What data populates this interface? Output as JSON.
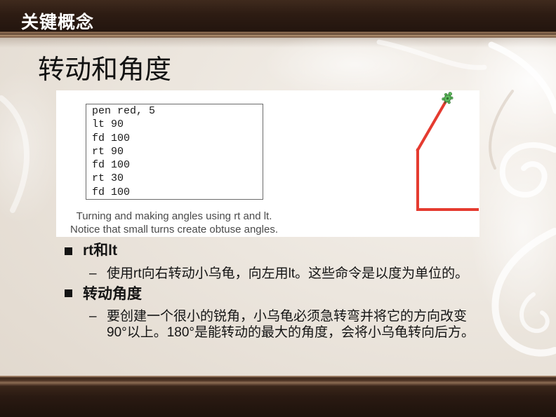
{
  "header": {
    "title": "关键概念"
  },
  "slide": {
    "title": "转动和角度"
  },
  "figure": {
    "code_lines": [
      "pen red, 5",
      "lt 90",
      "fd 100",
      "rt 90",
      "fd 100",
      "rt 30",
      "fd 100"
    ],
    "caption_lines": [
      "Turning and making angles using rt and lt.",
      "Notice that small turns create obtuse angles."
    ],
    "pen_color": "#e53b30",
    "turtle_color": "#5cb85c"
  },
  "bullets": [
    {
      "marker_icon": "square-bullet",
      "label": "rt和lt",
      "sub_marker": "–",
      "sub_lines": [
        "使用rt向右转动小乌龟，向左用lt。这些命令是以度为单位的。"
      ]
    },
    {
      "marker_icon": "square-bullet",
      "label": "转动角度",
      "sub_marker": "–",
      "sub_lines": [
        "要创建一个很小的锐角，小乌龟必须急转弯并将它的方向改变",
        "90°以上。180°是能转动的最大的角度，会将小乌龟转向后方。"
      ]
    }
  ],
  "theme": {
    "header_bg": "#2d1c13",
    "header_text": "#ffffff",
    "slide_bg": "#ebe5dd"
  }
}
